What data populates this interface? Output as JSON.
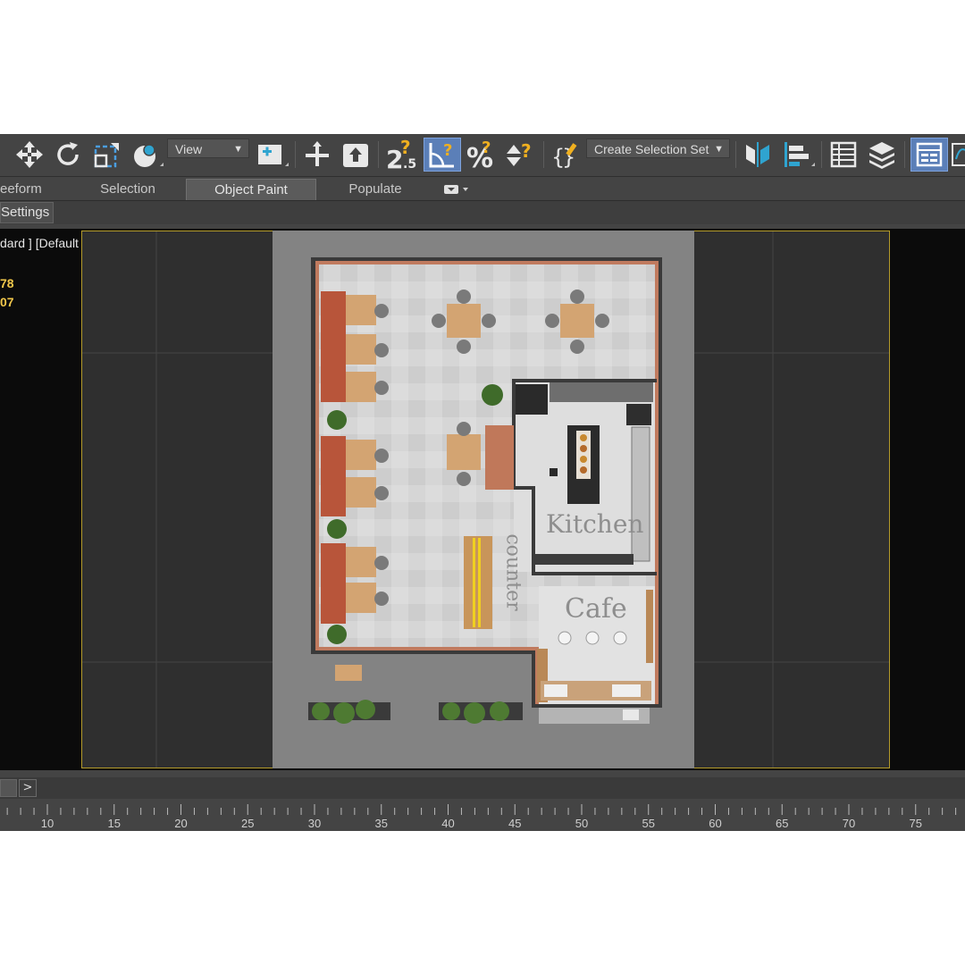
{
  "toolbar": {
    "view_dropdown": "View",
    "selection_set_dropdown": "Create Selection Set",
    "icons": [
      "move-icon",
      "rotate-icon",
      "scale-icon",
      "placement-icon",
      "pivot-icon",
      "select-and-link-icon",
      "snap-2-5d-icon",
      "angle-snap-icon",
      "percent-snap-icon",
      "spinner-snap-icon",
      "edit-named-sets-icon",
      "mirror-icon",
      "align-icon",
      "scene-explorer-icon",
      "layer-explorer-icon",
      "toggle-ribbon-icon"
    ]
  },
  "ribbon": {
    "tabs": [
      {
        "label": "eeform"
      },
      {
        "label": "Selection"
      },
      {
        "label": "Object Paint",
        "active": true
      },
      {
        "label": "Populate"
      }
    ]
  },
  "settings_tab": "Settings",
  "viewport": {
    "label": "dard ] [Default Shading ]",
    "stat_1": "78",
    "stat_2": "07",
    "labels": {
      "kitchen": "Kitchen",
      "cafe": "Cafe",
      "counter": "counter"
    }
  },
  "timeline": {
    "next_button": ">",
    "ticks": [
      "10",
      "15",
      "20",
      "25",
      "30",
      "35",
      "40",
      "45",
      "50",
      "55",
      "60",
      "65",
      "70",
      "75"
    ]
  },
  "colors": {
    "viewport_border": "#b49b2a",
    "active_button": "#5b7fb8",
    "stat_text": "#f2c84b"
  }
}
